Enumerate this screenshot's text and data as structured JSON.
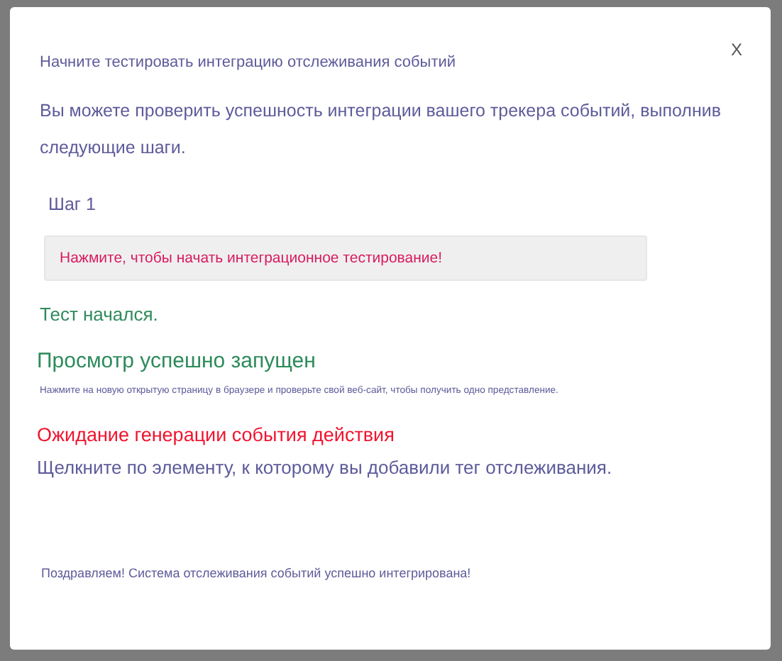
{
  "dialog": {
    "title": "Начните тестировать интеграцию отслеживания событий",
    "close_label": "X",
    "intro": "Вы можете проверить успешность интеграции вашего трекера событий, выполнив следующие шаги.",
    "step_label": "Шаг 1",
    "start_button": "Нажмите, чтобы начать интеграционное тестирование!",
    "status_started": "Тест начался.",
    "view_heading": "Просмотр успешно запущен",
    "view_hint": "Нажмите на новую открытую страницу в браузере и проверьте свой веб-сайт, чтобы получить одно представление.",
    "waiting_heading": "Ожидание генерации события действия",
    "waiting_hint": "Щелкните по элементу, к которому вы добавили тег отслеживания.",
    "success_message": "Поздравляем! Система отслеживания событий успешно интегрирована!"
  }
}
